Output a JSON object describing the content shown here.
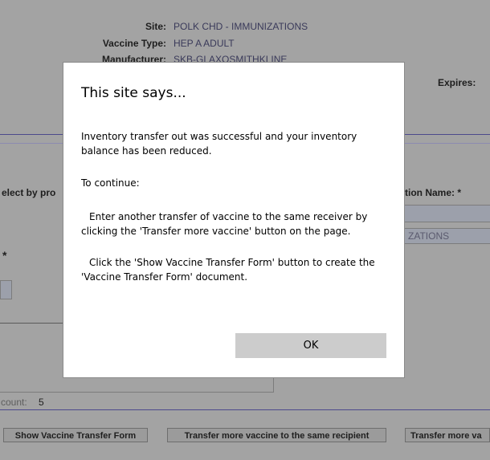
{
  "header": {
    "site_label": "Site:",
    "site_value": "POLK CHD - IMMUNIZATIONS",
    "vaccine_type_label": "Vaccine Type:",
    "vaccine_type_value": "HEP A ADULT",
    "manufacturer_label": "Manufacturer:",
    "manufacturer_value": "SKB-GLAXOSMITHKLINE",
    "expires_label": "Expires:"
  },
  "form": {
    "select_by_label": "elect by pro",
    "location_name_label": "tion Name: *",
    "location_value": "ZATIONS",
    "asterisk": "*",
    "count_label": "count:",
    "count_value": "5"
  },
  "buttons": {
    "show_form": "Show Vaccine Transfer Form",
    "transfer_same": "Transfer more vaccine to the same recipient",
    "transfer_more": "Transfer more va"
  },
  "dialog": {
    "title": "This site says...",
    "message1": "Inventory transfer out was successful and your inventory balance has been reduced.",
    "message2": "To continue:",
    "message3": "Enter another transfer of vaccine to the same receiver by clicking the 'Transfer more vaccine' button on the page.",
    "message4": "Click the 'Show Vaccine Transfer Form' button to create the 'Vaccine Transfer Form' document.",
    "ok_label": "OK"
  },
  "colors": {
    "overlay": "#a3a3a3",
    "rule": "#4c4a8c",
    "dialog_bg": "#ffffff",
    "ok_bg": "#cccccc"
  }
}
